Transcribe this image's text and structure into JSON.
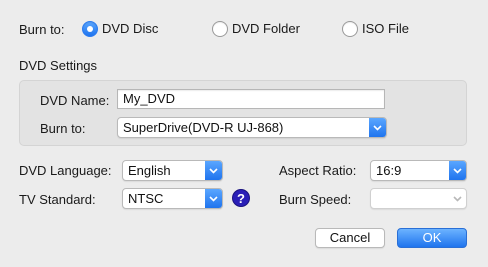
{
  "burn_to": {
    "label": "Burn to:",
    "options": [
      {
        "label": "DVD Disc",
        "selected": true
      },
      {
        "label": "DVD Folder",
        "selected": false
      },
      {
        "label": "ISO File",
        "selected": false
      }
    ]
  },
  "dvd_settings": {
    "heading": "DVD Settings",
    "name_label": "DVD Name:",
    "name_value": "My_DVD",
    "burn_label": "Burn to:",
    "burn_value": "SuperDrive(DVD-R   UJ-868)"
  },
  "options": {
    "language_label": "DVD Language:",
    "language_value": "English",
    "tv_label": "TV Standard:",
    "tv_value": "NTSC",
    "help_glyph": "?",
    "aspect_label": "Aspect Ratio:",
    "aspect_value": "16:9",
    "speed_label": "Burn Speed:",
    "speed_value": ""
  },
  "buttons": {
    "cancel": "Cancel",
    "ok": "OK"
  },
  "colors": {
    "accent": "#1f74ee",
    "help": "#2a1fb7",
    "window": "#ececec"
  }
}
